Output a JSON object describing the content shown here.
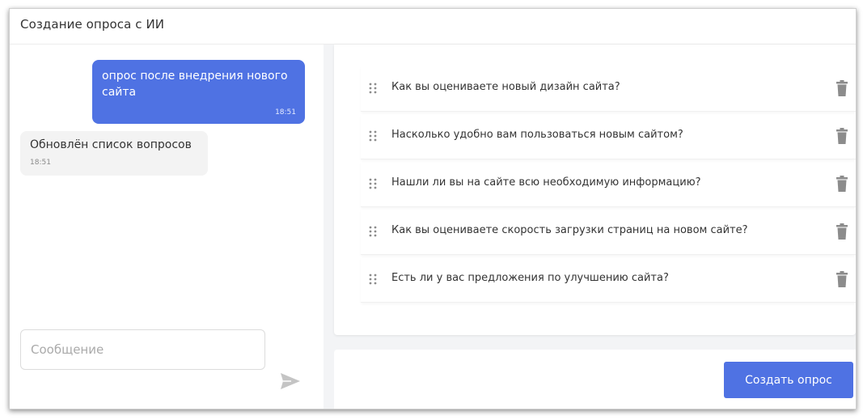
{
  "window": {
    "title": "Создание опроса с ИИ"
  },
  "chat": {
    "messages": [
      {
        "direction": "outgoing",
        "text": "опрос после внедрения нового сайта",
        "time": "18:51"
      },
      {
        "direction": "incoming",
        "text": "Обновлён список вопросов",
        "time": "18:51"
      }
    ],
    "input": {
      "value": "",
      "placeholder": "Сообщение"
    },
    "send_icon": "send-arrow-icon"
  },
  "questions": [
    {
      "text": "Как вы оцениваете новый дизайн сайта?"
    },
    {
      "text": "Насколько удобно вам пользоваться новым сайтом?"
    },
    {
      "text": "Нашли ли вы на сайте всю необходимую информацию?"
    },
    {
      "text": "Как вы оцениваете скорость загрузки страниц на новом сайте?"
    },
    {
      "text": "Есть ли у вас предложения по улучшению сайта?"
    }
  ],
  "actions": {
    "create_survey_label": "Создать опрос"
  },
  "colors": {
    "accent": "#4f72e3",
    "panel_bg": "#f3f4f6",
    "icon_gray": "#8c8c8c"
  }
}
